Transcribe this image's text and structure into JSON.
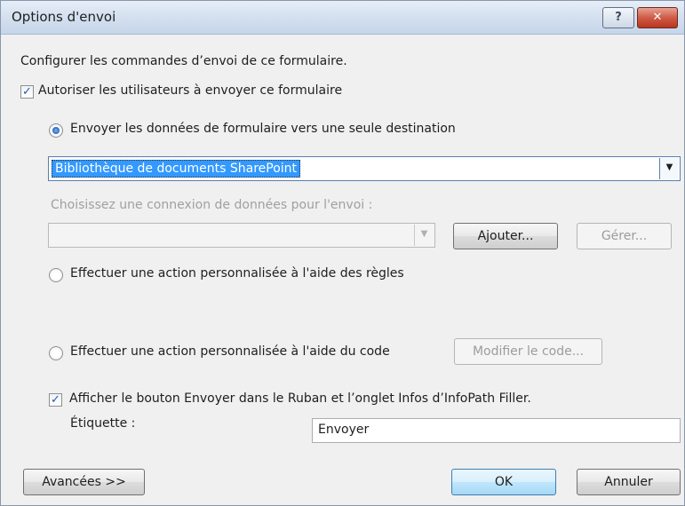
{
  "window": {
    "title": "Options d'envoi",
    "help_label": "?",
    "close_label": "✕"
  },
  "intro": "Configurer les commandes d’envoi de ce formulaire.",
  "allow_submit": {
    "label": "Autoriser les utilisateurs à envoyer ce formulaire",
    "checked": true
  },
  "single_destination": {
    "label": "Envoyer les données de formulaire vers une seule destination",
    "selected": true,
    "dropdown_value": "Bibliothèque de documents SharePoint"
  },
  "data_connection": {
    "label": "Choisissez une connexion de données pour l'envoi :",
    "value": "",
    "add_label": "Ajouter...",
    "manage_label": "Gérer..."
  },
  "rules_option": {
    "label": "Effectuer une action personnalisée à l'aide des règles",
    "selected": false
  },
  "code_option": {
    "label": "Effectuer une action personnalisée à l'aide du code",
    "selected": false,
    "edit_code_label": "Modifier le code..."
  },
  "show_button": {
    "label": "Afficher le bouton Envoyer dans le Ruban et l’onglet Infos d’InfoPath Filler.",
    "checked": true,
    "caption_label": "Étiquette :",
    "caption_value": "Envoyer"
  },
  "footer": {
    "advanced_label": "Avancées >>",
    "ok_label": "OK",
    "cancel_label": "Annuler"
  },
  "colors": {
    "title_bar": "#c6d5ea",
    "close_button": "#cf5b46",
    "selection": "#3399ff",
    "default_button": "#a7d9f5"
  },
  "icons": [
    "help-icon",
    "close-icon",
    "check-icon",
    "radio-dot-icon",
    "dropdown-arrow-icon"
  ]
}
